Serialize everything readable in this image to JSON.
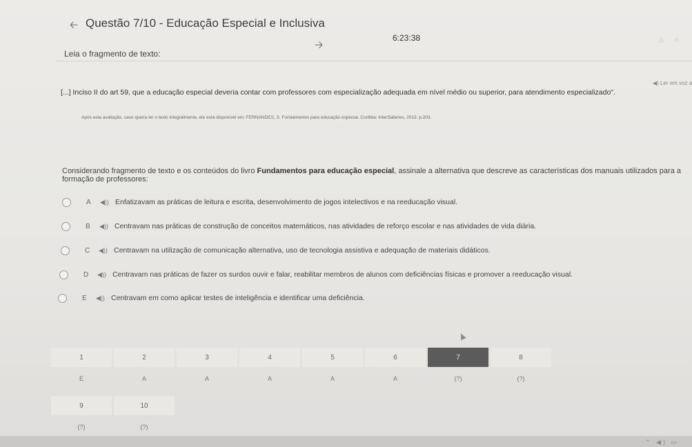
{
  "header": {
    "title": "Questão 7/10 - Educação Especial e Inclusiva",
    "timer": "6:23:38",
    "back_icon": "arrow-left-icon",
    "next_icon": "arrow-right-icon"
  },
  "content": {
    "read_label": "Leia o fragmento de texto:",
    "listen_label": "◀) Ler em voz alta",
    "quote": "[...] Inciso II do art 59, que a educação especial deveria contar com professores com especialização adequada em nível médio ou superior, para atendimento especializado\".",
    "source": "Após esta avaliação, caso queira ler o texto integralmente, ele está disponível em: FERNANDES, S. Fundamentos para educação especial. Curitiba: InterSaberes, 2013. p.203.",
    "prompt_pre": "Considerando fragmento de texto e os conteúdos do livro ",
    "prompt_bold": "Fundamentos para educação especial",
    "prompt_post": ", assinale a alternativa que descreve as características dos manuais utilizados para a formação de professores:"
  },
  "options": [
    {
      "letter": "A",
      "text": "Enfatizavam as práticas de leitura e escrita, desenvolvimento de jogos intelectivos e na reeducação visual."
    },
    {
      "letter": "B",
      "text": "Centravam nas práticas de construção de conceitos matemáticos, nas atividades de reforço escolar e nas atividades de vida diária."
    },
    {
      "letter": "C",
      "text": "Centravam na utilização de comunicação alternativa, uso de tecnologia assistiva e adequação de materiais didáticos."
    },
    {
      "letter": "D",
      "text": "Centravam nas práticas de fazer os surdos ouvir e falar, reabilitar membros de alunos com deficiências físicas e promover a reeducação visual."
    },
    {
      "letter": "E",
      "text": "Centravam em como aplicar testes de inteligência e identificar uma deficiência."
    }
  ],
  "navigator": {
    "numbers": [
      "1",
      "2",
      "3",
      "4",
      "5",
      "6",
      "7",
      "8",
      "9",
      "10"
    ],
    "answers": [
      "E",
      "A",
      "A",
      "A",
      "A",
      "A",
      "(?)",
      "(?)",
      "(?)",
      "(?)"
    ],
    "active_index": 6
  }
}
